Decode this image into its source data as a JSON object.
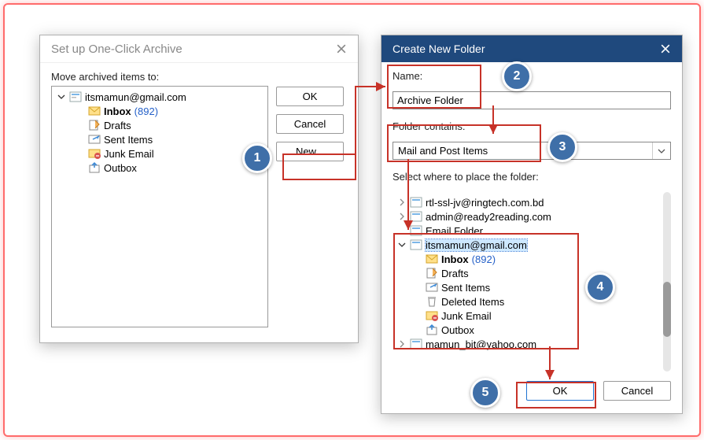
{
  "dlg1": {
    "title": "Set up One-Click Archive",
    "move_label": "Move archived items to:",
    "account": "itsmamun@gmail.com",
    "inbox": "Inbox",
    "inbox_count": "(892)",
    "drafts": "Drafts",
    "sent": "Sent Items",
    "junk": "Junk Email",
    "outbox": "Outbox",
    "ok": "OK",
    "cancel": "Cancel",
    "new": "New..."
  },
  "dlg2": {
    "title": "Create New Folder",
    "name_label": "Name:",
    "name_value": "Archive Folder",
    "contains_label": "Folder contains:",
    "contains_value": "Mail and Post Items",
    "place_label": "Select where to place the folder:",
    "accounts": {
      "a1": "rtl-ssl-jv@ringtech.com.bd",
      "a2": "admin@ready2reading.com",
      "a3": "Email Folder",
      "a4": "itsmamun@gmail.com",
      "a5": "mamun_bit@yahoo.com"
    },
    "folders": {
      "inbox": "Inbox",
      "inbox_count": "(892)",
      "drafts": "Drafts",
      "sent": "Sent Items",
      "deleted": "Deleted Items",
      "junk": "Junk Email",
      "outbox": "Outbox"
    },
    "ok": "OK",
    "cancel": "Cancel"
  },
  "callouts": {
    "1": "1",
    "2": "2",
    "3": "3",
    "4": "4",
    "5": "5"
  }
}
